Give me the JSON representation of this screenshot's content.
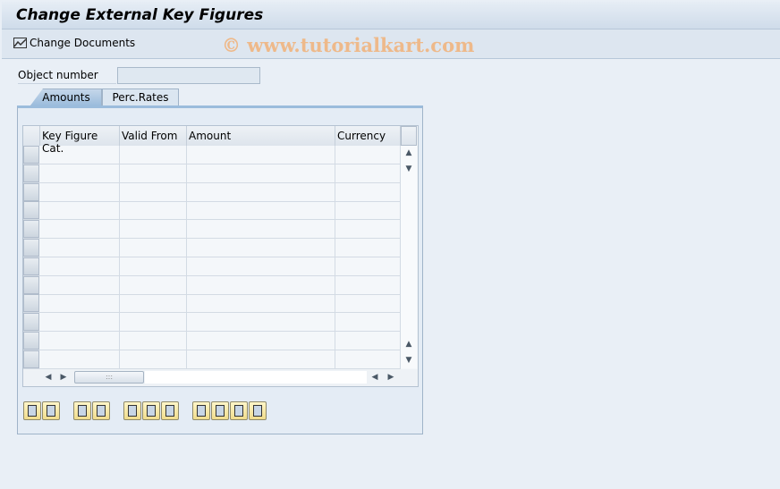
{
  "title": "Change External Key Figures",
  "toolbar": {
    "change_documents": "Change Documents"
  },
  "watermark": "© www.tutorialkart.com",
  "form": {
    "object_number_label": "Object number",
    "object_number_value": ""
  },
  "tabs": [
    {
      "label": "Amounts",
      "active": true
    },
    {
      "label": "Perc.Rates",
      "active": false
    }
  ],
  "table": {
    "columns": [
      "Key Figure Cat.",
      "Valid From",
      "Amount",
      "Currency"
    ],
    "rows": 12
  },
  "buttons": [
    "insert-row",
    "delete-row",
    "sort-ascending",
    "sort-descending",
    "select-all",
    "select-block",
    "deselect-all",
    "page-top",
    "page-up",
    "page-down",
    "page-bottom"
  ]
}
